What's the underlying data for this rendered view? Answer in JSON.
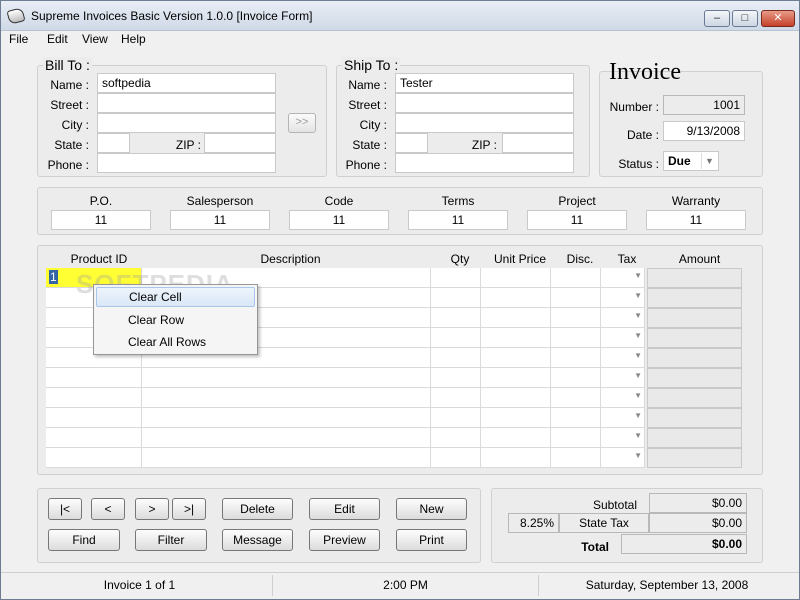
{
  "window": {
    "title": "Supreme Invoices Basic Version 1.0.0  [Invoice Form]",
    "min_glyph": "–",
    "max_glyph": "□",
    "close_glyph": "✕"
  },
  "menu": [
    "File",
    "Edit",
    "View",
    "Help"
  ],
  "bill_to": {
    "title": "Bill To :",
    "name_label": "Name :",
    "name": "softpedia",
    "street_label": "Street :",
    "street": "",
    "city_label": "City :",
    "city": "",
    "state_label": "State :",
    "state": "",
    "zip_label": "ZIP :",
    "zip": "",
    "phone_label": "Phone :",
    "phone": "",
    "copy_button": ">>"
  },
  "ship_to": {
    "title": "Ship To :",
    "name_label": "Name :",
    "name": "Tester",
    "street_label": "Street :",
    "street": "",
    "city_label": "City :",
    "city": "",
    "state_label": "State :",
    "state": "",
    "zip_label": "ZIP :",
    "zip": "",
    "phone_label": "Phone :",
    "phone": ""
  },
  "invoice": {
    "heading": "Invoice",
    "number_label": "Number :",
    "number": "1001",
    "date_label": "Date :",
    "date": "9/13/2008",
    "status_label": "Status :",
    "status": "Due"
  },
  "meta": {
    "labels": [
      "P.O.",
      "Salesperson",
      "Code",
      "Terms",
      "Project",
      "Warranty"
    ],
    "values": [
      "11",
      "11",
      "11",
      "11",
      "11",
      "11"
    ]
  },
  "grid": {
    "headers": [
      "Product ID",
      "Description",
      "Qty",
      "Unit Price",
      "Disc.",
      "Tax",
      "Amount"
    ],
    "active_cell_value": "1",
    "row_count": 10
  },
  "context_menu": {
    "items": [
      "Clear Cell",
      "Clear Row",
      "Clear All Rows"
    ]
  },
  "nav": {
    "first": "|<",
    "prev": "<",
    "next": ">",
    "last": ">|",
    "delete": "Delete",
    "edit": "Edit",
    "new": "New",
    "find": "Find",
    "filter": "Filter",
    "message": "Message",
    "preview": "Preview",
    "print": "Print"
  },
  "totals": {
    "subtotal_label": "Subtotal",
    "subtotal": "$0.00",
    "tax_rate": "8.25%",
    "state_tax_label": "State Tax",
    "state_tax": "$0.00",
    "total_label": "Total",
    "total": "$0.00"
  },
  "status": {
    "record": "Invoice 1 of 1",
    "time": "2:00 PM",
    "date": "Saturday, September 13, 2008"
  },
  "watermark": "SOFTPEDIA"
}
